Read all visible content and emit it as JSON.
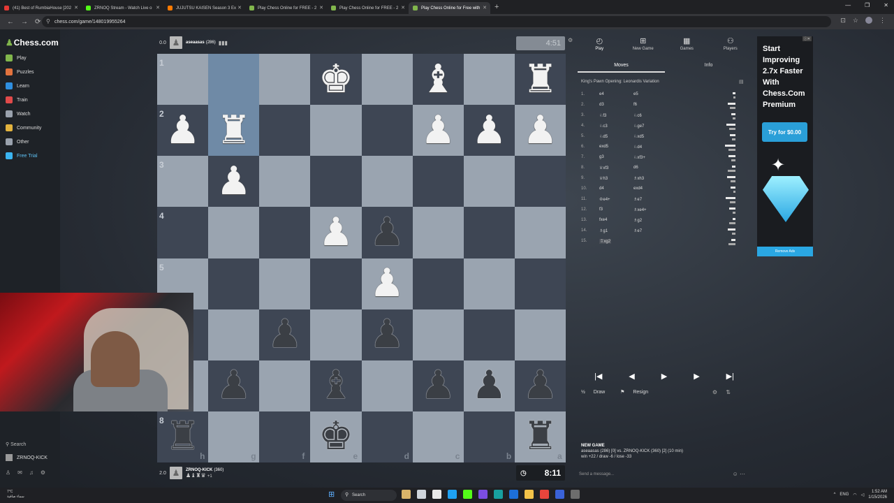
{
  "browser": {
    "tabs": [
      {
        "title": "(41) Best of RumbiaHouse [202",
        "color": "#e53935",
        "active": false
      },
      {
        "title": "ZRNOQ Stream - Watch Live o",
        "color": "#53fc18",
        "active": false
      },
      {
        "title": "JUJUTSU KAISEN Season 3 Ex",
        "color": "#ff7a00",
        "active": false
      },
      {
        "title": "Play Chess Online for FREE - 2",
        "color": "#81b64c",
        "active": false
      },
      {
        "title": "Play Chess Online for FREE - 2",
        "color": "#81b64c",
        "active": false
      },
      {
        "title": "Play Chess Online for Free with",
        "color": "#81b64c",
        "active": true
      }
    ],
    "url": "chess.com/game/148019955264"
  },
  "sidebar": {
    "logo": "Chess.com",
    "items": [
      {
        "label": "Play",
        "icon": "play-icon",
        "color": "#81b64c"
      },
      {
        "label": "Puzzles",
        "icon": "puzzle-icon",
        "color": "#e2733e"
      },
      {
        "label": "Learn",
        "icon": "learn-icon",
        "color": "#2f8fe0"
      },
      {
        "label": "Train",
        "icon": "train-icon",
        "color": "#e04a4a"
      },
      {
        "label": "Watch",
        "icon": "watch-icon",
        "color": "#9aa2ad"
      },
      {
        "label": "Community",
        "icon": "community-icon",
        "color": "#e2b33e"
      },
      {
        "label": "Other",
        "icon": "more-icon",
        "color": "#9aa2ad"
      },
      {
        "label": "Free Trial",
        "icon": "diamond-icon",
        "color": "#3bb4f0"
      }
    ],
    "search": "Search",
    "username": "ZRNOQ-KICK"
  },
  "game": {
    "top_player": {
      "score": "0.0",
      "name": "aseaasas",
      "rating": "(286)",
      "clock": "4:51"
    },
    "bottom_player": {
      "score": "2.0",
      "name": "ZRNOQ-KICK",
      "rating": "(360)",
      "captured_extra": "+1",
      "clock": "8:11"
    },
    "ranks": [
      "1",
      "2",
      "3",
      "4",
      "5",
      "6",
      "7",
      "8"
    ],
    "files": [
      "h",
      "g",
      "f",
      "e",
      "d",
      "c",
      "b",
      "a"
    ],
    "highlight": [
      [
        0,
        1
      ],
      [
        1,
        1
      ]
    ],
    "pieces": [
      {
        "r": 0,
        "c": 3,
        "p": "K",
        "side": "w"
      },
      {
        "r": 0,
        "c": 5,
        "p": "B",
        "side": "w"
      },
      {
        "r": 0,
        "c": 7,
        "p": "R",
        "side": "w"
      },
      {
        "r": 1,
        "c": 0,
        "p": "P",
        "side": "w"
      },
      {
        "r": 1,
        "c": 1,
        "p": "R",
        "side": "w"
      },
      {
        "r": 1,
        "c": 5,
        "p": "P",
        "side": "w"
      },
      {
        "r": 1,
        "c": 6,
        "p": "P",
        "side": "w"
      },
      {
        "r": 1,
        "c": 7,
        "p": "P",
        "side": "w"
      },
      {
        "r": 2,
        "c": 1,
        "p": "P",
        "side": "w"
      },
      {
        "r": 3,
        "c": 3,
        "p": "P",
        "side": "w"
      },
      {
        "r": 3,
        "c": 4,
        "p": "P",
        "side": "b"
      },
      {
        "r": 4,
        "c": 4,
        "p": "P",
        "side": "w"
      },
      {
        "r": 5,
        "c": 2,
        "p": "P",
        "side": "b"
      },
      {
        "r": 5,
        "c": 4,
        "p": "P",
        "side": "b"
      },
      {
        "r": 6,
        "c": 1,
        "p": "P",
        "side": "b"
      },
      {
        "r": 6,
        "c": 3,
        "p": "B",
        "side": "b"
      },
      {
        "r": 6,
        "c": 5,
        "p": "P",
        "side": "b"
      },
      {
        "r": 6,
        "c": 6,
        "p": "P",
        "side": "b"
      },
      {
        "r": 6,
        "c": 7,
        "p": "P",
        "side": "b"
      },
      {
        "r": 7,
        "c": 0,
        "p": "R",
        "side": "b"
      },
      {
        "r": 7,
        "c": 3,
        "p": "K",
        "side": "b"
      },
      {
        "r": 7,
        "c": 7,
        "p": "R",
        "side": "b"
      }
    ]
  },
  "panel": {
    "nav": [
      {
        "label": "Play",
        "icon": "stopwatch-icon",
        "active": true
      },
      {
        "label": "New Game",
        "icon": "plus-icon",
        "active": false
      },
      {
        "label": "Games",
        "icon": "games-icon",
        "active": false
      },
      {
        "label": "Players",
        "icon": "players-icon",
        "active": false
      }
    ],
    "tabs": [
      {
        "label": "Moves",
        "active": true
      },
      {
        "label": "Info",
        "active": false
      }
    ],
    "opening": "King's Pawn Opening: Leonardis Variation",
    "moves": [
      {
        "n": "1.",
        "w": "e4",
        "b": "e5"
      },
      {
        "n": "2.",
        "w": "d3",
        "b": "f6"
      },
      {
        "n": "3.",
        "w": "♘f3",
        "b": "♘c6"
      },
      {
        "n": "4.",
        "w": "♘c3",
        "b": "♘ge7"
      },
      {
        "n": "5.",
        "w": "♘d5",
        "b": "♘xd5"
      },
      {
        "n": "6.",
        "w": "exd5",
        "b": "♘d4"
      },
      {
        "n": "7.",
        "w": "g3",
        "b": "♘xf3+"
      },
      {
        "n": "8.",
        "w": "♕xf3",
        "b": "d6"
      },
      {
        "n": "9.",
        "w": "♕h3",
        "b": "♗xh3"
      },
      {
        "n": "10.",
        "w": "d4",
        "b": "exd4"
      },
      {
        "n": "11.",
        "w": "♔e4+",
        "b": "♗e7"
      },
      {
        "n": "12.",
        "w": "f3",
        "b": "♗xe4+"
      },
      {
        "n": "13.",
        "w": "fxe4",
        "b": "♗g2"
      },
      {
        "n": "14.",
        "w": "♗g1",
        "b": "♗e7"
      },
      {
        "n": "15.",
        "w": "♖xg2",
        "b": ""
      }
    ],
    "controls": [
      {
        "name": "first-move-button",
        "icon": "⏮"
      },
      {
        "name": "prev-move-button",
        "icon": "◀"
      },
      {
        "name": "play-button",
        "icon": "▶"
      },
      {
        "name": "next-move-button",
        "icon": "▶"
      },
      {
        "name": "last-move-button",
        "icon": "⏭"
      }
    ],
    "draw_label": "Draw",
    "resign_label": "Resign",
    "new_game_title": "NEW GAME",
    "new_game_line": "aseaasas (286) [0] vs. ZRNOQ-KICK (360) [2] (10 min)",
    "record_line": "win +22 / draw -6 / lose -33",
    "message_placeholder": "Send a message..."
  },
  "ad": {
    "headline": "Start Improving 2.7x Faster With Chess.Com Premium",
    "button": "Try for $0.00",
    "footer": "Remove Ads"
  },
  "taskbar": {
    "weather_temp": "7°C",
    "weather_desc": "سماء صافية",
    "search": "Search",
    "lang": "ENG",
    "time": "1:52 AM",
    "date": "1/15/2026"
  }
}
